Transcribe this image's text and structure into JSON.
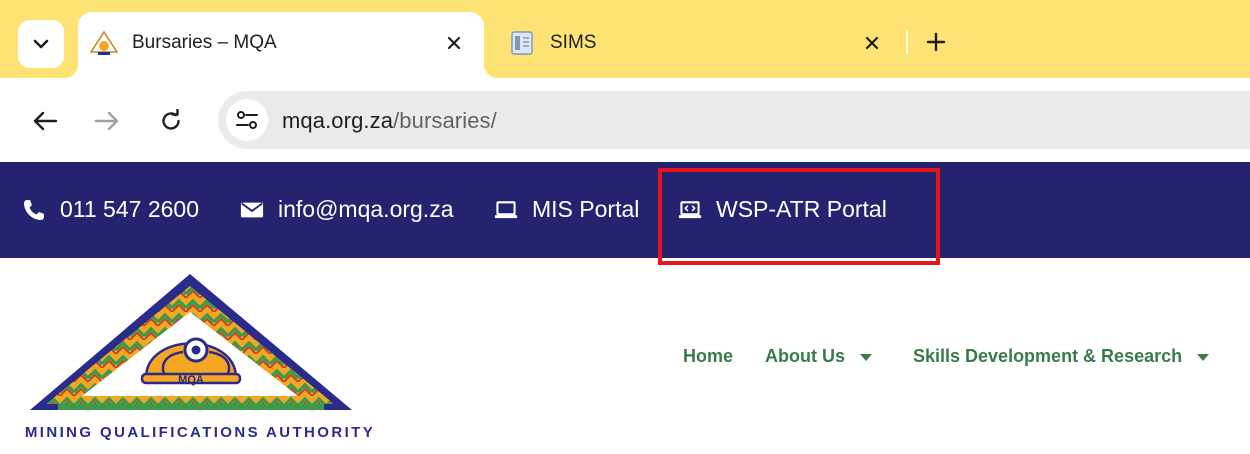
{
  "browser": {
    "tabs": [
      {
        "title": "Bursaries – MQA",
        "active": true,
        "favicon": "mqa-favicon-icon"
      },
      {
        "title": "SIMS",
        "active": false,
        "favicon": "document-icon"
      }
    ],
    "url_host": "mqa.org.za",
    "url_path": "/bursaries/",
    "tabstrip_color": "#fde374"
  },
  "topbar": {
    "background": "#24236f",
    "phone": "011 547 2600",
    "email": "info@mqa.org.za",
    "mis_portal": "MIS Portal",
    "wsp_portal": "WSP-ATR Portal",
    "highlight_color": "#e8141c"
  },
  "logo": {
    "badge": "MQA",
    "caption": "MINING QUALIFICATIONS AUTHORITY"
  },
  "nav": {
    "color": "#3a7a4a",
    "items": [
      {
        "label": "Home",
        "has_dropdown": false
      },
      {
        "label": "About Us",
        "has_dropdown": true
      },
      {
        "label": "Skills Development & Research",
        "has_dropdown": true
      }
    ]
  }
}
